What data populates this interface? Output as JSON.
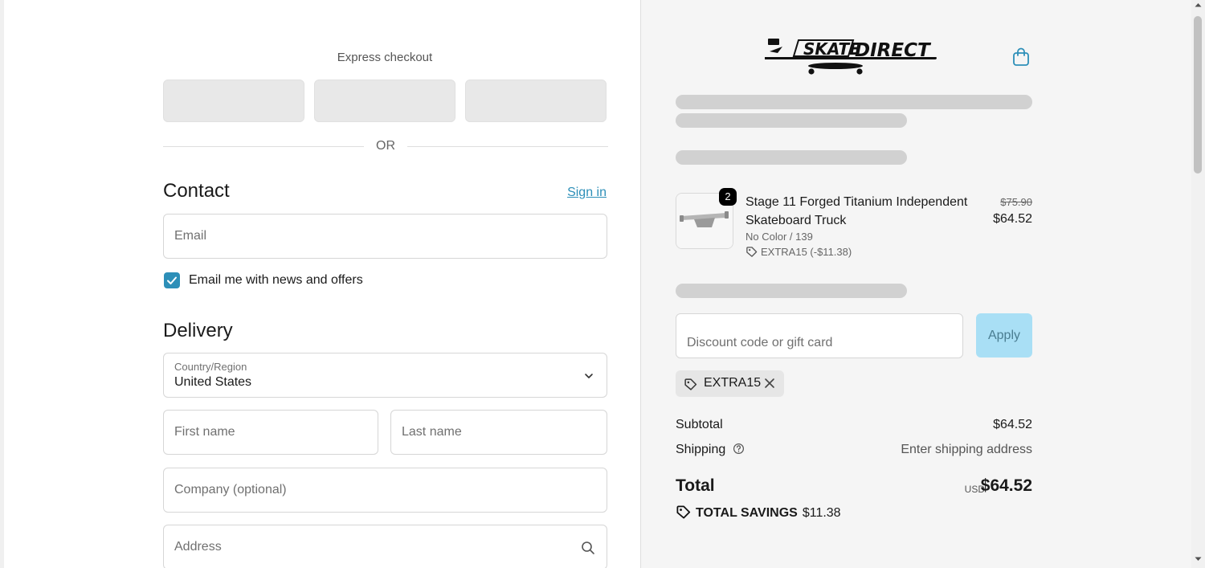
{
  "express": {
    "title": "Express checkout",
    "or_text": "OR"
  },
  "contact": {
    "title": "Contact",
    "signin_label": "Sign in",
    "email_placeholder": "Email",
    "news_label": "Email me with news and offers",
    "news_checked": true
  },
  "delivery": {
    "title": "Delivery",
    "country_label": "Country/Region",
    "country_value": "United States",
    "first_name_placeholder": "First name",
    "last_name_placeholder": "Last name",
    "company_placeholder": "Company (optional)",
    "address_placeholder": "Address"
  },
  "brand": {
    "accent": "#2d8fb8",
    "apply_bg": "#a9dff5"
  },
  "cart": {
    "item": {
      "quantity": "2",
      "name": "Stage 11 Forged Titanium Independent Skateboard Truck",
      "variant": "No Color / 139",
      "discount": "EXTRA15 (-$11.38)",
      "original_price": "$75.90",
      "price": "$64.52"
    },
    "discount_placeholder": "Discount code or gift card",
    "apply_label": "Apply",
    "applied_code": "EXTRA15"
  },
  "summary": {
    "subtotal_label": "Subtotal",
    "subtotal_value": "$64.52",
    "shipping_label": "Shipping",
    "shipping_value": "Enter shipping address",
    "total_label": "Total",
    "currency": "USD",
    "total_value": "$64.52",
    "savings_label": "TOTAL SAVINGS",
    "savings_value": "$11.38"
  }
}
